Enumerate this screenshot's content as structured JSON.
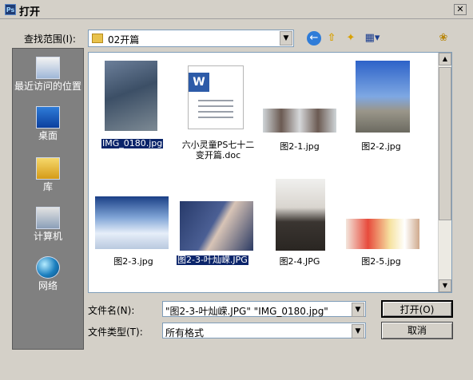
{
  "window": {
    "app_icon_text": "Ps",
    "title": "打开",
    "close_glyph": "✕"
  },
  "toolbar": {
    "lookin_label": "查找范围(I):",
    "lookin_value": "02开篇",
    "dropdown_glyph": "▼",
    "back_glyph": "←",
    "up_glyph": "⇧",
    "newfolder_glyph": "✦",
    "views_glyph": "▦▾",
    "extra_glyph": "❀"
  },
  "places": [
    {
      "label": "最近访问的位置",
      "icon": "recent-places-icon"
    },
    {
      "label": "桌面",
      "icon": "desktop-icon"
    },
    {
      "label": "库",
      "icon": "library-icon"
    },
    {
      "label": "计算机",
      "icon": "computer-icon"
    },
    {
      "label": "网络",
      "icon": "network-icon"
    }
  ],
  "files": [
    {
      "name": "IMG_0180.jpg",
      "selected": true
    },
    {
      "name_line1": "六小灵童PS七十二",
      "name_line2": "变开篇.doc",
      "doc_letter": "W"
    },
    {
      "name": "图2-1.jpg"
    },
    {
      "name": "图2-2.jpg"
    },
    {
      "name": "图2-3.jpg"
    },
    {
      "name": "图2-3-叶灿嵘.JPG",
      "selected": true
    },
    {
      "name": "图2-4.JPG"
    },
    {
      "name": "图2-5.jpg"
    }
  ],
  "scrollbar": {
    "up_glyph": "▲",
    "down_glyph": "▼"
  },
  "filename": {
    "label": "文件名(N):",
    "value": "\"图2-3-叶灿嵘.JPG\" \"IMG_0180.jpg\""
  },
  "filetype": {
    "label": "文件类型(T):",
    "value": "所有格式"
  },
  "buttons": {
    "open": "打开(O)",
    "cancel": "取消"
  },
  "colors": {
    "selection": "#0a246a",
    "dialog_bg": "#d4d0c8",
    "places_bg": "#808080"
  }
}
